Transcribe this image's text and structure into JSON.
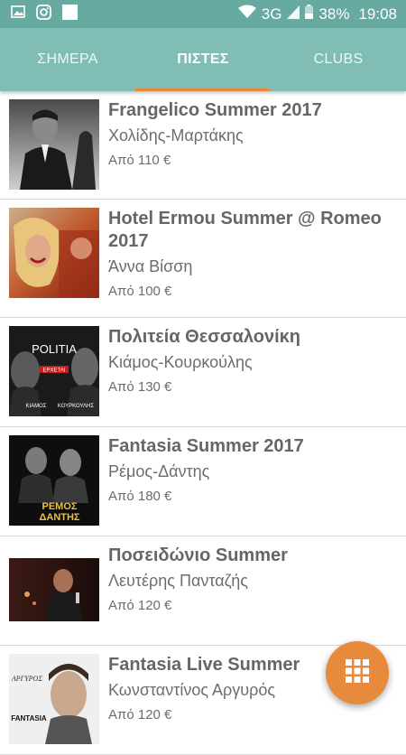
{
  "status_bar": {
    "network": "3G",
    "battery": "38%",
    "time": "19:08",
    "icons": [
      "gallery-icon",
      "instagram-icon",
      "app-icon",
      "wifi-icon",
      "signal-icon",
      "battery-icon"
    ]
  },
  "tabs": [
    {
      "label": "ΣΗΜΕΡΑ",
      "active": false
    },
    {
      "label": "ΠΙΣΤΕΣ",
      "active": true
    },
    {
      "label": "CLUBS",
      "active": false
    }
  ],
  "events": [
    {
      "title": "Frangelico Summer 2017",
      "artist": "Χολίδης-Μαρτάκης",
      "price": "Από 110 €"
    },
    {
      "title": "Hotel Ermou Summer @ Romeo 2017",
      "artist": "Άννα Βίσση",
      "price": "Από 100 €"
    },
    {
      "title": "Πολιτεία Θεσσαλονίκη",
      "artist": "Κιάμος-Κουρκούλης",
      "price": "Από 130 €"
    },
    {
      "title": "Fantasia Summer 2017",
      "artist": "Ρέμος-Δάντης",
      "price": "Από 180 €"
    },
    {
      "title": "Ποσειδώνιο Summer",
      "artist": "Λευτέρης Πανταζής",
      "price": "Από 120 €"
    },
    {
      "title": "Fantasia Live Summer",
      "artist": "Κωνσταντίνος Αργυρός",
      "price": "Από 120 €"
    }
  ],
  "posters": {
    "politeia": {
      "logo": "POLITIA",
      "sub": "ΕΡΧΕΤΑΙ",
      "name_left": "ΚΙΑΜΟΣ",
      "name_right": "ΚΟΥΡΚΟΥΛΗΣ"
    },
    "fantasia": {
      "line1": "ΡΕΜΟΣ",
      "line2": "ΔΑΝΤΗΣ"
    },
    "argyros": {
      "logo": "FANTASIA",
      "name": "ΑΡΓΥΡΟΣ"
    }
  },
  "colors": {
    "status_bar": "#67aaa1",
    "tab_bar": "#7fbdb5",
    "accent": "#e88a3c",
    "title_text": "#666666"
  },
  "fab": {
    "icon": "grid-icon"
  }
}
